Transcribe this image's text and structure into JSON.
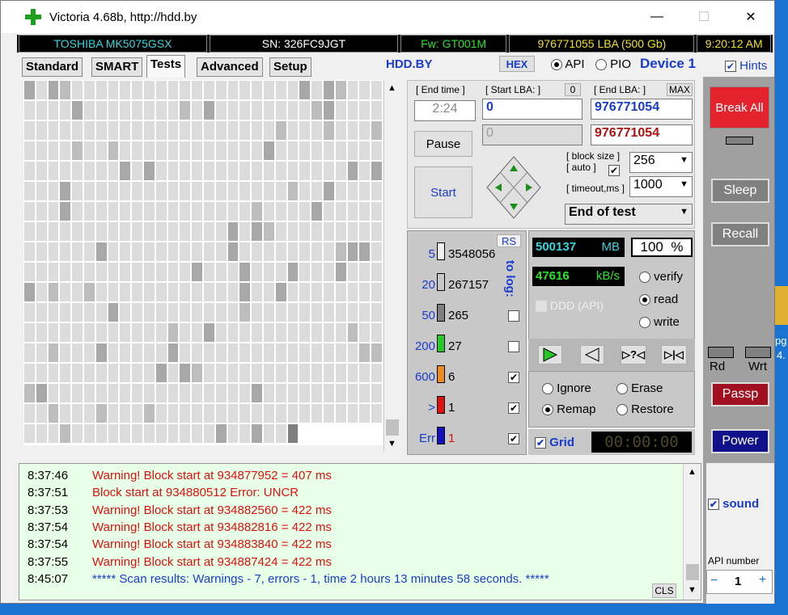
{
  "window": {
    "title": "Victoria 4.68b, http://hdd.by",
    "minimize": "—",
    "maximize": "☐",
    "close": "✕"
  },
  "infobar": {
    "model": "TOSHIBA MK5075GSX",
    "serial": "SN: 326FC9JGT",
    "firmware": "Fw: GT001M",
    "lba": "976771055 LBA (500 Gb)",
    "clock": "9:20:12 AM"
  },
  "tabs": [
    "Standard",
    "SMART",
    "Tests",
    "Advanced",
    "Setup"
  ],
  "active_tab": "Tests",
  "header": {
    "site": "HDD.BY",
    "hex": "HEX",
    "api": "API",
    "pio": "PIO",
    "device": "Device 1",
    "hints": "Hints"
  },
  "test": {
    "end_time_label": "[ End time ]",
    "end_time": "2:24",
    "start_lba_label": "[ Start LBA: ]",
    "start_lba_zero": "0",
    "start_lba": "0",
    "current_lba": "0",
    "end_lba_label": "[ End LBA: ]",
    "end_lba_max": "MAX",
    "end_lba": "976771054",
    "end_lba2": "976771054",
    "pause": "Pause",
    "start": "Start",
    "block_size_label": "[ block size ]",
    "auto_label": "[ auto ]",
    "block_size": "256",
    "timeout_label": "[ timeout,ms ]",
    "timeout": "1000",
    "end_action": "End of test"
  },
  "stats": {
    "rs": "RS",
    "to_log": "to log:",
    "rows": [
      {
        "ms": "5",
        "count": "3548056",
        "color": "#f0f0f0",
        "checked": false
      },
      {
        "ms": "20",
        "count": "267157",
        "color": "#c8c8c8",
        "checked": false
      },
      {
        "ms": "50",
        "count": "265",
        "color": "#808080",
        "checked": false
      },
      {
        "ms": "200",
        "count": "27",
        "color": "#22cc22",
        "checked": false
      },
      {
        "ms": "600",
        "count": "6",
        "color": "#f08a1a",
        "checked": true
      },
      {
        "ms": ">",
        "count": "1",
        "color": "#e01010",
        "checked": true
      },
      {
        "ms": "Err",
        "count": "1",
        "color": "#1010c0",
        "checked": true
      }
    ]
  },
  "progress": {
    "mb": "500137",
    "mb_unit": "MB",
    "percent": "100",
    "percent_unit": "%",
    "speed": "47616",
    "speed_unit": "kB/s",
    "ddd": "DDD (API)"
  },
  "mode": {
    "verify": "verify",
    "read": "read",
    "write": "write",
    "selected": "read"
  },
  "repair": {
    "ignore": "Ignore",
    "erase": "Erase",
    "remap": "Remap",
    "restore": "Restore",
    "selected": "Remap"
  },
  "grid_toggle": "Grid",
  "timer": "00:00:00",
  "side": {
    "break_all": "Break All",
    "sleep": "Sleep",
    "recall": "Recall",
    "rd": "Rd",
    "wrt": "Wrt",
    "passp": "Passp",
    "power": "Power",
    "sound": "sound",
    "api_number_label": "API number",
    "api_number": "1",
    "minus": "−",
    "plus": "+"
  },
  "log": [
    {
      "time": "8:37:46",
      "msg": "Warning! Block start at 934877952 = 407 ms",
      "color": "#e01010"
    },
    {
      "time": "8:37:51",
      "msg": "Block start at 934880512 Error: UNCR",
      "color": "#e01010"
    },
    {
      "time": "8:37:53",
      "msg": "Warning! Block start at 934882560 = 422 ms",
      "color": "#e01010"
    },
    {
      "time": "8:37:54",
      "msg": "Warning! Block start at 934882816 = 422 ms",
      "color": "#e01010"
    },
    {
      "time": "8:37:54",
      "msg": "Warning! Block start at 934883840 = 422 ms",
      "color": "#e01010"
    },
    {
      "time": "8:37:55",
      "msg": "Warning! Block start at 934887424 = 422 ms",
      "color": "#e01010"
    },
    {
      "time": "8:45:07",
      "msg": "***** Scan results: Warnings - 7, errors - 1, time 2 hours 13 minutes 58 seconds.  *****",
      "color": "#1a3ccc"
    }
  ],
  "cls": "CLS",
  "desktop": {
    "label1": "pg",
    "label2": "4."
  }
}
